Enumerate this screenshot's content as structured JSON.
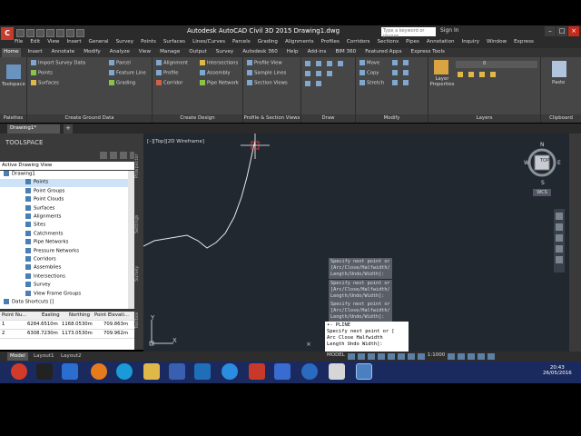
{
  "window": {
    "title": "Autodesk AutoCAD Civil 3D 2015   Drawing1.dwg",
    "search_placeholder": "Type a keyword or phrase",
    "sign_in": "Sign In",
    "app_letter": "C"
  },
  "menubar": [
    "File",
    "Edit",
    "View",
    "Insert",
    "General",
    "Survey",
    "Points",
    "Surfaces",
    "Lines/Curves",
    "Parcels",
    "Grading",
    "Alignments",
    "Profiles",
    "Corridors",
    "Sections",
    "Pipes",
    "Annotation",
    "Inquiry",
    "Window",
    "Express"
  ],
  "ribbon_tabs": [
    "Home",
    "Insert",
    "Annotate",
    "Modify",
    "Analyze",
    "View",
    "Manage",
    "Output",
    "Survey",
    "Autodesk 360",
    "Help",
    "Add-ins",
    "BIM 360",
    "Featured Apps",
    "Express Tools"
  ],
  "ribbon": {
    "palettes": {
      "title": "Palettes",
      "toolspace": "Toolspace"
    },
    "ground": {
      "title": "Create Ground Data",
      "items": [
        "Import Survey Data",
        "Points",
        "Surfaces"
      ]
    },
    "ground2": {
      "items": [
        "Parcel",
        "Feature Line",
        "Grading"
      ]
    },
    "design": {
      "title": "Create Design",
      "items": [
        "Alignment",
        "Profile",
        "Corridor",
        "Intersections",
        "Assembly",
        "Pipe Network"
      ]
    },
    "profsec": {
      "title": "Profile & Section Views",
      "items": [
        "Profile View",
        "Sample Lines",
        "Section Views"
      ]
    },
    "draw": {
      "title": "Draw"
    },
    "modify": {
      "title": "Modify",
      "items": [
        "Move",
        "Copy",
        "Stretch"
      ]
    },
    "layers": {
      "title": "Layers",
      "layer_props": "Layer Properties",
      "current_layer": "0"
    },
    "clipboard": {
      "title": "Clipboard",
      "paste": "Paste"
    }
  },
  "doc_tab": "Drawing1*",
  "toolspace": {
    "title": "TOOLSPACE",
    "dropdown": "Active Drawing View",
    "tree": [
      {
        "label": "Drawing1",
        "indent": 0,
        "selected": false
      },
      {
        "label": "Points",
        "indent": 2,
        "selected": true
      },
      {
        "label": "Point Groups",
        "indent": 2,
        "selected": false
      },
      {
        "label": "Point Clouds",
        "indent": 2,
        "selected": false
      },
      {
        "label": "Surfaces",
        "indent": 2,
        "selected": false
      },
      {
        "label": "Alignments",
        "indent": 2,
        "selected": false
      },
      {
        "label": "Sites",
        "indent": 2,
        "selected": false
      },
      {
        "label": "Catchments",
        "indent": 2,
        "selected": false
      },
      {
        "label": "Pipe Networks",
        "indent": 2,
        "selected": false
      },
      {
        "label": "Pressure Networks",
        "indent": 2,
        "selected": false
      },
      {
        "label": "Corridors",
        "indent": 2,
        "selected": false
      },
      {
        "label": "Assemblies",
        "indent": 2,
        "selected": false
      },
      {
        "label": "Intersections",
        "indent": 2,
        "selected": false
      },
      {
        "label": "Survey",
        "indent": 2,
        "selected": false
      },
      {
        "label": "View Frame Groups",
        "indent": 2,
        "selected": false
      },
      {
        "label": "Data Shortcuts []",
        "indent": 0,
        "selected": false
      }
    ],
    "side_tabs": [
      "Prospector",
      "Settings",
      "Survey",
      "Toolbox"
    ],
    "table": {
      "headers": [
        "Point Nu...",
        "Easting",
        "Northing",
        "Point Elevati..."
      ],
      "rows": [
        [
          "1",
          "6284.6510m",
          "1168.0530m",
          "709.863m"
        ],
        [
          "2",
          "6308.7230m",
          "1173.0530m",
          "709.962m"
        ]
      ]
    }
  },
  "drawing": {
    "view_label": "[–][Top][2D Wireframe]",
    "viewcube": {
      "n": "N",
      "s": "S",
      "e": "E",
      "w": "W",
      "face": "TOP"
    },
    "wcs": "WCS",
    "ucs_x": "X",
    "ucs_y": "Y"
  },
  "command": {
    "history": [
      "Specify next point or\n[Arc/Close/Halfwidth/\nLength/Undo/Width]:",
      "Specify next point or\n[Arc/Close/Halfwidth/\nLength/Undo/Width]:",
      "Specify next point or\n[Arc/Close/Halfwidth/\nLength/Undo/Width]:"
    ],
    "current": "•- PLINE\nSpecify next point or [\nArc Close Halfwidth\nLength Undo Width]:"
  },
  "layout_tabs": [
    "Model",
    "Layout1",
    "Layout2"
  ],
  "status": {
    "model": "MODEL",
    "scale": "1:1000"
  },
  "taskbar": {
    "time": "20:43",
    "date": "26/05/2016"
  }
}
